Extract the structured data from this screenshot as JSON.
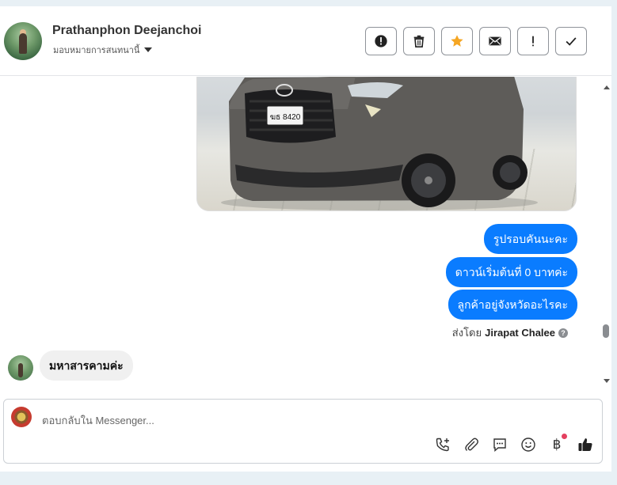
{
  "header": {
    "contact_name": "Prathanphon Deejanchoi",
    "assign_label": "มอบหมายการสนทนานี้",
    "actions": [
      {
        "name": "spam-button",
        "icon": "alert-circle-icon"
      },
      {
        "name": "delete-button",
        "icon": "trash-icon"
      },
      {
        "name": "star-button",
        "icon": "star-icon"
      },
      {
        "name": "mark-unread-button",
        "icon": "mail-icon"
      },
      {
        "name": "follow-up-button",
        "icon": "exclamation-icon"
      },
      {
        "name": "done-button",
        "icon": "check-icon"
      }
    ]
  },
  "messages": {
    "outgoing": [
      "รูปรอบคันนะคะ",
      "ดาวน์เริ่มต้นที่ 0 บาทค่ะ",
      "ลูกค้าอยู่จังหวัดอะไรคะ"
    ],
    "sent_by_prefix": "ส่งโดย",
    "sent_by_name": "Jirapat Chalee",
    "help_glyph": "?",
    "incoming": "มหาสารคามค่ะ",
    "plate_text": "ฆธ 8420"
  },
  "composer": {
    "placeholder": "ตอบกลับใน Messenger...",
    "baht_symbol": "฿"
  },
  "colors": {
    "accent": "#0a7cff",
    "star": "#f5a623",
    "notification_dot": "#e4405f",
    "incoming_bubble": "#f0f0f0"
  }
}
